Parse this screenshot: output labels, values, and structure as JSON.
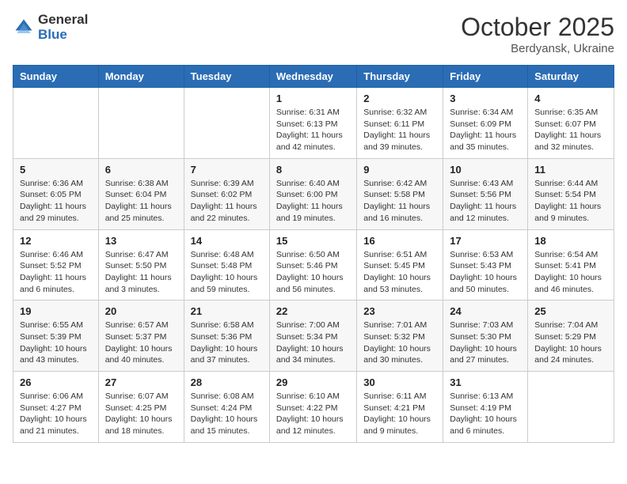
{
  "header": {
    "logo_general": "General",
    "logo_blue": "Blue",
    "title": "October 2025",
    "location": "Berdyansk, Ukraine"
  },
  "weekdays": [
    "Sunday",
    "Monday",
    "Tuesday",
    "Wednesday",
    "Thursday",
    "Friday",
    "Saturday"
  ],
  "weeks": [
    [
      {
        "day": "",
        "info": ""
      },
      {
        "day": "",
        "info": ""
      },
      {
        "day": "",
        "info": ""
      },
      {
        "day": "1",
        "info": "Sunrise: 6:31 AM\nSunset: 6:13 PM\nDaylight: 11 hours\nand 42 minutes."
      },
      {
        "day": "2",
        "info": "Sunrise: 6:32 AM\nSunset: 6:11 PM\nDaylight: 11 hours\nand 39 minutes."
      },
      {
        "day": "3",
        "info": "Sunrise: 6:34 AM\nSunset: 6:09 PM\nDaylight: 11 hours\nand 35 minutes."
      },
      {
        "day": "4",
        "info": "Sunrise: 6:35 AM\nSunset: 6:07 PM\nDaylight: 11 hours\nand 32 minutes."
      }
    ],
    [
      {
        "day": "5",
        "info": "Sunrise: 6:36 AM\nSunset: 6:05 PM\nDaylight: 11 hours\nand 29 minutes."
      },
      {
        "day": "6",
        "info": "Sunrise: 6:38 AM\nSunset: 6:04 PM\nDaylight: 11 hours\nand 25 minutes."
      },
      {
        "day": "7",
        "info": "Sunrise: 6:39 AM\nSunset: 6:02 PM\nDaylight: 11 hours\nand 22 minutes."
      },
      {
        "day": "8",
        "info": "Sunrise: 6:40 AM\nSunset: 6:00 PM\nDaylight: 11 hours\nand 19 minutes."
      },
      {
        "day": "9",
        "info": "Sunrise: 6:42 AM\nSunset: 5:58 PM\nDaylight: 11 hours\nand 16 minutes."
      },
      {
        "day": "10",
        "info": "Sunrise: 6:43 AM\nSunset: 5:56 PM\nDaylight: 11 hours\nand 12 minutes."
      },
      {
        "day": "11",
        "info": "Sunrise: 6:44 AM\nSunset: 5:54 PM\nDaylight: 11 hours\nand 9 minutes."
      }
    ],
    [
      {
        "day": "12",
        "info": "Sunrise: 6:46 AM\nSunset: 5:52 PM\nDaylight: 11 hours\nand 6 minutes."
      },
      {
        "day": "13",
        "info": "Sunrise: 6:47 AM\nSunset: 5:50 PM\nDaylight: 11 hours\nand 3 minutes."
      },
      {
        "day": "14",
        "info": "Sunrise: 6:48 AM\nSunset: 5:48 PM\nDaylight: 10 hours\nand 59 minutes."
      },
      {
        "day": "15",
        "info": "Sunrise: 6:50 AM\nSunset: 5:46 PM\nDaylight: 10 hours\nand 56 minutes."
      },
      {
        "day": "16",
        "info": "Sunrise: 6:51 AM\nSunset: 5:45 PM\nDaylight: 10 hours\nand 53 minutes."
      },
      {
        "day": "17",
        "info": "Sunrise: 6:53 AM\nSunset: 5:43 PM\nDaylight: 10 hours\nand 50 minutes."
      },
      {
        "day": "18",
        "info": "Sunrise: 6:54 AM\nSunset: 5:41 PM\nDaylight: 10 hours\nand 46 minutes."
      }
    ],
    [
      {
        "day": "19",
        "info": "Sunrise: 6:55 AM\nSunset: 5:39 PM\nDaylight: 10 hours\nand 43 minutes."
      },
      {
        "day": "20",
        "info": "Sunrise: 6:57 AM\nSunset: 5:37 PM\nDaylight: 10 hours\nand 40 minutes."
      },
      {
        "day": "21",
        "info": "Sunrise: 6:58 AM\nSunset: 5:36 PM\nDaylight: 10 hours\nand 37 minutes."
      },
      {
        "day": "22",
        "info": "Sunrise: 7:00 AM\nSunset: 5:34 PM\nDaylight: 10 hours\nand 34 minutes."
      },
      {
        "day": "23",
        "info": "Sunrise: 7:01 AM\nSunset: 5:32 PM\nDaylight: 10 hours\nand 30 minutes."
      },
      {
        "day": "24",
        "info": "Sunrise: 7:03 AM\nSunset: 5:30 PM\nDaylight: 10 hours\nand 27 minutes."
      },
      {
        "day": "25",
        "info": "Sunrise: 7:04 AM\nSunset: 5:29 PM\nDaylight: 10 hours\nand 24 minutes."
      }
    ],
    [
      {
        "day": "26",
        "info": "Sunrise: 6:06 AM\nSunset: 4:27 PM\nDaylight: 10 hours\nand 21 minutes."
      },
      {
        "day": "27",
        "info": "Sunrise: 6:07 AM\nSunset: 4:25 PM\nDaylight: 10 hours\nand 18 minutes."
      },
      {
        "day": "28",
        "info": "Sunrise: 6:08 AM\nSunset: 4:24 PM\nDaylight: 10 hours\nand 15 minutes."
      },
      {
        "day": "29",
        "info": "Sunrise: 6:10 AM\nSunset: 4:22 PM\nDaylight: 10 hours\nand 12 minutes."
      },
      {
        "day": "30",
        "info": "Sunrise: 6:11 AM\nSunset: 4:21 PM\nDaylight: 10 hours\nand 9 minutes."
      },
      {
        "day": "31",
        "info": "Sunrise: 6:13 AM\nSunset: 4:19 PM\nDaylight: 10 hours\nand 6 minutes."
      },
      {
        "day": "",
        "info": ""
      }
    ]
  ]
}
